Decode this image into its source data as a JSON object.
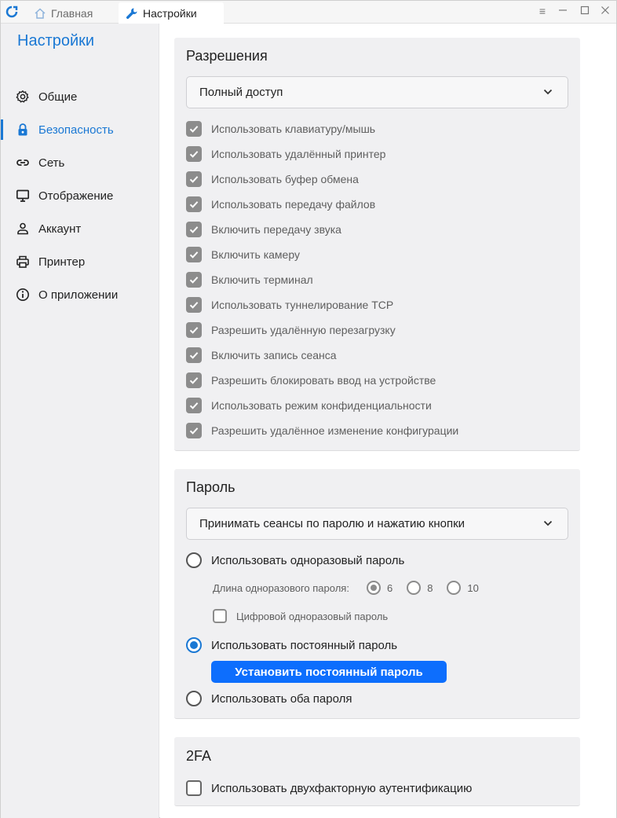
{
  "titlebar": {
    "tabs": [
      {
        "label": "Главная",
        "icon": "home-icon"
      },
      {
        "label": "Настройки",
        "icon": "wrench-icon"
      }
    ]
  },
  "sidebar": {
    "title": "Настройки",
    "items": [
      {
        "label": "Общие",
        "icon": "gear-icon"
      },
      {
        "label": "Безопасность",
        "icon": "lock-icon",
        "active": true
      },
      {
        "label": "Сеть",
        "icon": "link-icon"
      },
      {
        "label": "Отображение",
        "icon": "monitor-icon"
      },
      {
        "label": "Аккаунт",
        "icon": "user-icon"
      },
      {
        "label": "Принтер",
        "icon": "printer-icon"
      },
      {
        "label": "О приложении",
        "icon": "info-icon"
      }
    ]
  },
  "permissions": {
    "title": "Разрешения",
    "select_value": "Полный доступ",
    "options": [
      "Использовать клавиатуру/мышь",
      "Использовать удалённый принтер",
      "Использовать буфер обмена",
      "Использовать передачу файлов",
      "Включить передачу звука",
      "Включить камеру",
      "Включить терминал",
      "Использовать туннелирование TCP",
      "Разрешить удалённую перезагрузку",
      "Включить запись сеанса",
      "Разрешить блокировать ввод на устройстве",
      "Использовать режим конфиденциальности",
      "Разрешить удалённое изменение конфигурации"
    ]
  },
  "password": {
    "title": "Пароль",
    "select_value": "Принимать сеансы по паролю и нажатию кнопки",
    "one_time": "Использовать одноразовый пароль",
    "length_label": "Длина одноразового пароля:",
    "lengths": [
      "6",
      "8",
      "10"
    ],
    "numeric": "Цифровой одноразовый пароль",
    "permanent": "Использовать постоянный пароль",
    "set_button": "Установить постоянный пароль",
    "both": "Использовать оба пароля"
  },
  "twofa": {
    "title": "2FA",
    "option": "Использовать двухфакторную аутентификацию"
  },
  "colors": {
    "accent": "#1a78d4",
    "button": "#0d6efd",
    "checkbox": "#8c8c8c",
    "sidebar_bg": "#f0f0f2"
  }
}
